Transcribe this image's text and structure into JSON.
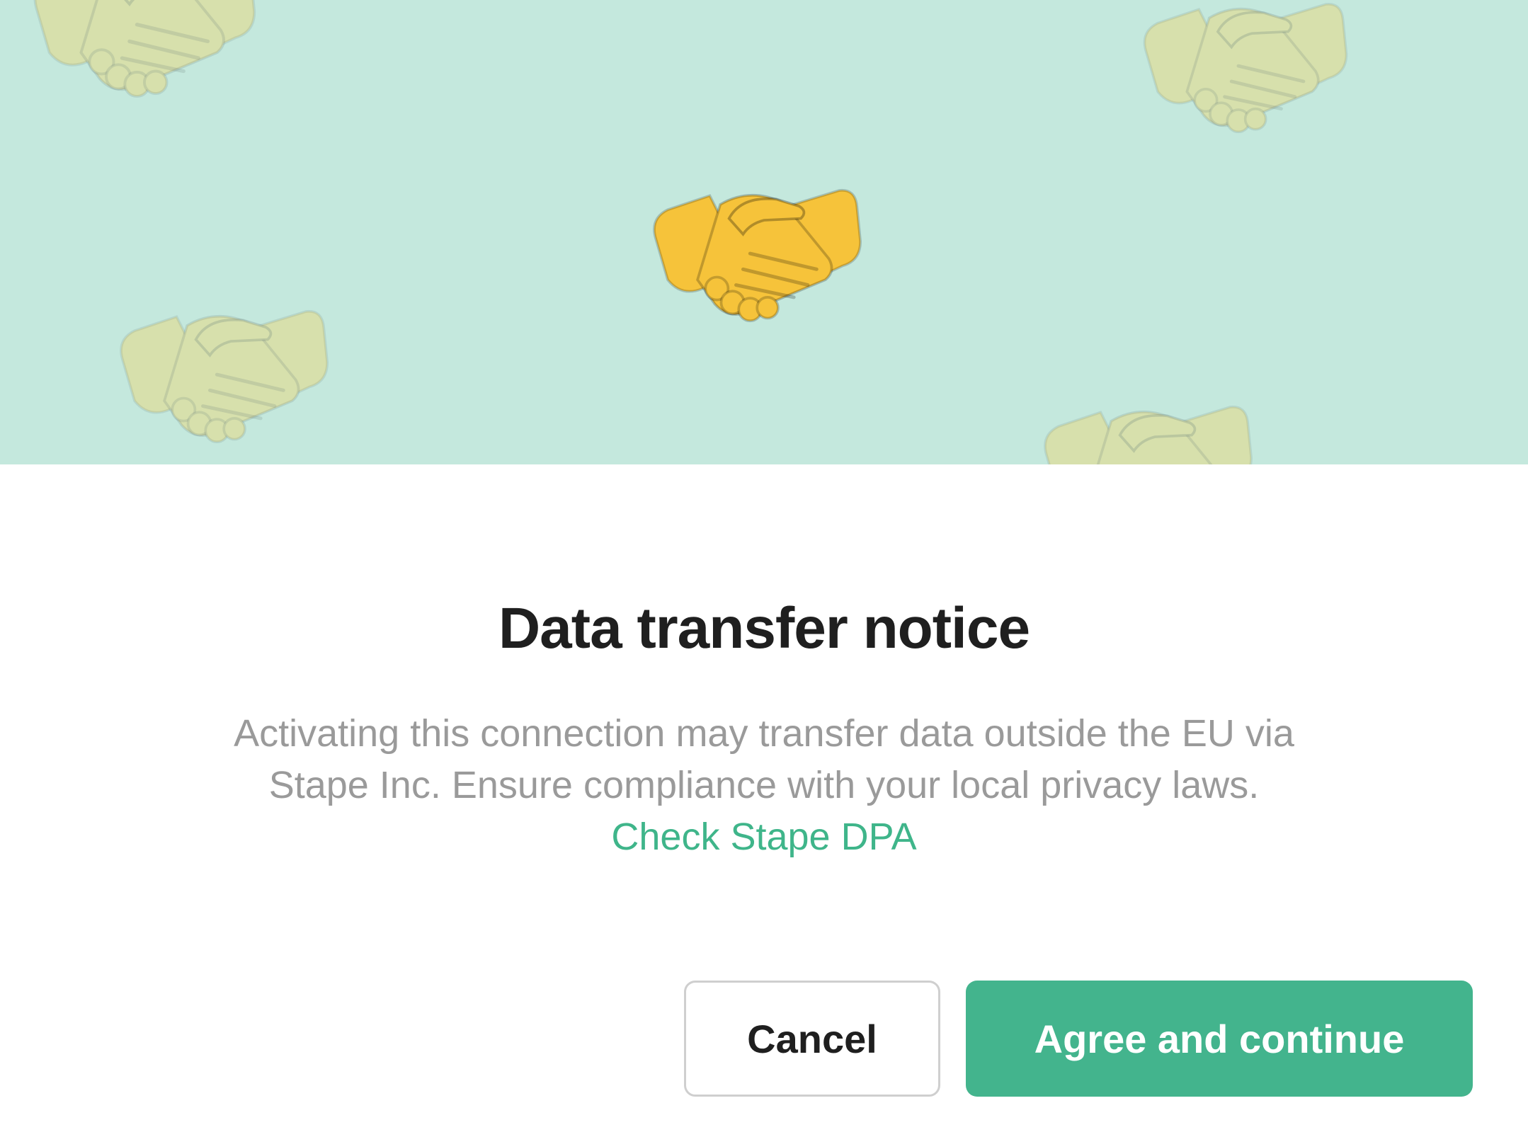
{
  "dialog": {
    "hero_icon": "handshake-icon",
    "hero_background_color": "#c4e8dd",
    "title": "Data transfer notice",
    "body_text": "Activating this connection may transfer data outside the EU via Stape Inc. Ensure compliance with your local privacy laws.",
    "link_text": "Check Stape DPA",
    "link_color": "#3fb58a",
    "cancel_label": "Cancel",
    "agree_label": "Agree and continue",
    "agree_color": "#43b48d"
  }
}
